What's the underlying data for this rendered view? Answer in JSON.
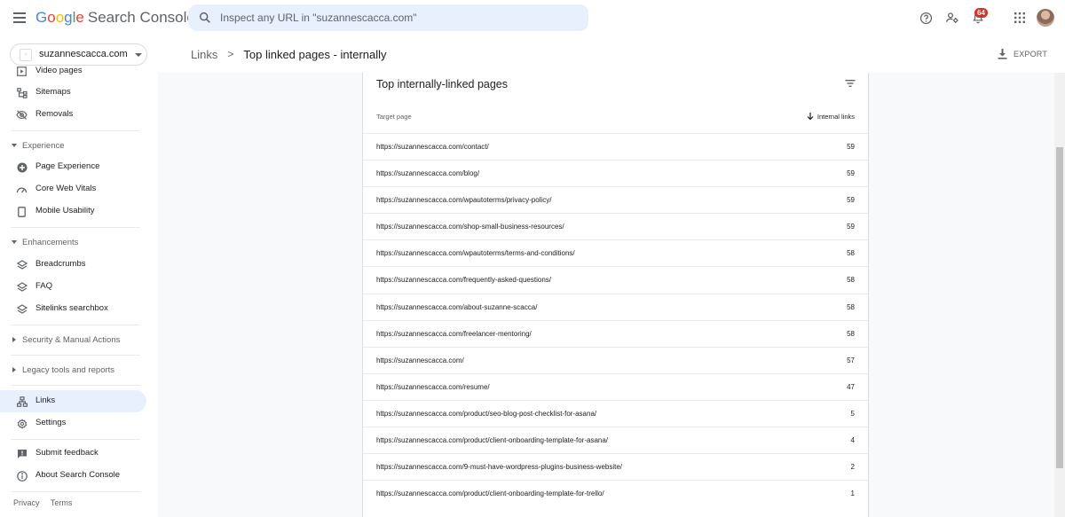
{
  "header": {
    "logo_google": "Google",
    "logo_product": "Search Console",
    "search_placeholder": "Inspect any URL in \"suzannescacca.com\"",
    "notifications_count": "64"
  },
  "sidebar": {
    "property": "suzannescacca.com",
    "top_items": [
      {
        "label": "Video pages",
        "icon": "video-pages-icon"
      },
      {
        "label": "Sitemaps",
        "icon": "sitemaps-icon"
      },
      {
        "label": "Removals",
        "icon": "removals-icon"
      }
    ],
    "experience": {
      "label": "Experience",
      "items": [
        {
          "label": "Page Experience",
          "icon": "page-experience-icon"
        },
        {
          "label": "Core Web Vitals",
          "icon": "core-web-vitals-icon"
        },
        {
          "label": "Mobile Usability",
          "icon": "mobile-usability-icon"
        }
      ]
    },
    "enhancements": {
      "label": "Enhancements",
      "items": [
        {
          "label": "Breadcrumbs",
          "icon": "layers-icon"
        },
        {
          "label": "FAQ",
          "icon": "layers-icon"
        },
        {
          "label": "Sitelinks searchbox",
          "icon": "layers-icon"
        }
      ]
    },
    "security": "Security & Manual Actions",
    "legacy": "Legacy tools and reports",
    "links": "Links",
    "settings": "Settings",
    "submit_feedback": "Submit feedback",
    "about": "About Search Console",
    "footer": {
      "privacy": "Privacy",
      "terms": "Terms"
    }
  },
  "page": {
    "breadcrumb_root": "Links",
    "breadcrumb_current": "Top linked pages - internally",
    "export_label": "EXPORT"
  },
  "card": {
    "title": "Top internally-linked pages",
    "col_target": "Target page",
    "col_links": "Internal links",
    "rows": [
      {
        "url": "https://suzannescacca.com/contact/",
        "links": "59"
      },
      {
        "url": "https://suzannescacca.com/blog/",
        "links": "59"
      },
      {
        "url": "https://suzannescacca.com/wpautoterms/privacy-policy/",
        "links": "59"
      },
      {
        "url": "https://suzannescacca.com/shop-small-business-resources/",
        "links": "59"
      },
      {
        "url": "https://suzannescacca.com/wpautoterms/terms-and-conditions/",
        "links": "58"
      },
      {
        "url": "https://suzannescacca.com/frequently-asked-questions/",
        "links": "58"
      },
      {
        "url": "https://suzannescacca.com/about-suzanne-scacca/",
        "links": "58"
      },
      {
        "url": "https://suzannescacca.com/freelancer-mentoring/",
        "links": "58"
      },
      {
        "url": "https://suzannescacca.com/",
        "links": "57"
      },
      {
        "url": "https://suzannescacca.com/resume/",
        "links": "47"
      },
      {
        "url": "https://suzannescacca.com/product/seo-blog-post-checklist-for-asana/",
        "links": "5"
      },
      {
        "url": "https://suzannescacca.com/product/client-onboarding-template-for-asana/",
        "links": "4"
      },
      {
        "url": "https://suzannescacca.com/9-must-have-wordpress-plugins-business-website/",
        "links": "2"
      },
      {
        "url": "https://suzannescacca.com/product/client-onboarding-template-for-trello/",
        "links": "1"
      }
    ]
  }
}
